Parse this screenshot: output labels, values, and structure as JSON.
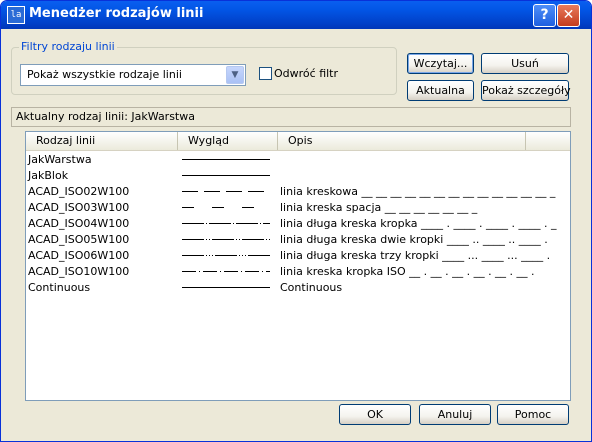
{
  "window": {
    "title": "Menedżer rodzajów linii",
    "help_glyph": "?",
    "close_glyph": "✕",
    "icon_glyph": "la"
  },
  "filter": {
    "group_label": "Filtry rodzaju linii",
    "selected": "Pokaż wszystkie rodzaje linii",
    "invert_label": "Odwróć filtr",
    "invert_checked": false
  },
  "buttons": {
    "load": "Wczytaj...",
    "delete": "Usuń",
    "current": "Aktualna",
    "details": "Pokaż szczegóły",
    "ok": "OK",
    "cancel": "Anuluj",
    "help": "Pomoc"
  },
  "current_linetype": "Aktualny rodzaj linii:  JakWarstwa",
  "columns": {
    "name": "Rodzaj linii",
    "look": "Wygląd",
    "desc": "Opis"
  },
  "rows": [
    {
      "name": "JakWarstwa",
      "pattern": "solid",
      "desc": ""
    },
    {
      "name": "JakBlok",
      "pattern": "solid",
      "desc": ""
    },
    {
      "name": "ACAD_ISO02W100",
      "pattern": "dashed",
      "desc": "linia kreskowa __ __ __ __ __ __ __ __ __ __ __ __ __ _"
    },
    {
      "name": "ACAD_ISO03W100",
      "pattern": "dashspace",
      "desc": "linia kreska spacja __    __    __    __    __    __    _"
    },
    {
      "name": "ACAD_ISO04W100",
      "pattern": "longdot",
      "desc": "linia długa kreska kropka ____ . ____ . ____ . ____ . _"
    },
    {
      "name": "ACAD_ISO05W100",
      "pattern": "longdots2",
      "desc": "linia długa kreska dwie kropki ____ .. ____ .. ____ ."
    },
    {
      "name": "ACAD_ISO06W100",
      "pattern": "longdots3",
      "desc": "linia długa kreska trzy kropki ____ ... ____ ... ____ ."
    },
    {
      "name": "ACAD_ISO10W100",
      "pattern": "dashdot",
      "desc": "linia kreska kropka ISO __ . __ . __ . __ . __ . __ ."
    },
    {
      "name": "Continuous",
      "pattern": "solid",
      "desc": "Continuous"
    }
  ]
}
